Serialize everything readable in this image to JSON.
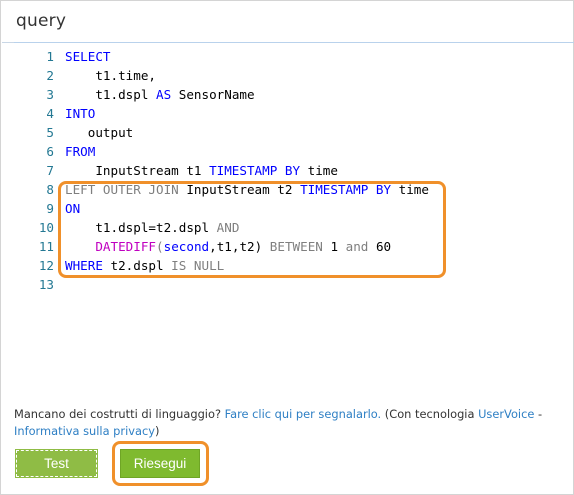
{
  "panel": {
    "title": "query"
  },
  "editor": {
    "lines": [
      {
        "n": "1",
        "tokens": [
          {
            "t": "SELECT",
            "c": "kw"
          }
        ]
      },
      {
        "n": "2",
        "tokens": [
          {
            "t": "    t1.time,",
            "c": "txt"
          }
        ]
      },
      {
        "n": "3",
        "tokens": [
          {
            "t": "    t1.dspl ",
            "c": "txt"
          },
          {
            "t": "AS",
            "c": "kw"
          },
          {
            "t": " SensorName",
            "c": "txt"
          }
        ]
      },
      {
        "n": "4",
        "tokens": [
          {
            "t": "INTO",
            "c": "kw"
          }
        ]
      },
      {
        "n": "5",
        "tokens": [
          {
            "t": "   output",
            "c": "txt"
          }
        ]
      },
      {
        "n": "6",
        "tokens": [
          {
            "t": "FROM",
            "c": "kw"
          }
        ]
      },
      {
        "n": "7",
        "tokens": [
          {
            "t": "    InputStream t1 ",
            "c": "txt"
          },
          {
            "t": "TIMESTAMP BY",
            "c": "kw"
          },
          {
            "t": " time",
            "c": "txt"
          }
        ]
      },
      {
        "n": "8",
        "tokens": [
          {
            "t": "LEFT OUTER JOIN",
            "c": "kw-gray"
          },
          {
            "t": " InputStream t2 ",
            "c": "txt"
          },
          {
            "t": "TIMESTAMP BY",
            "c": "kw"
          },
          {
            "t": " time",
            "c": "txt"
          }
        ]
      },
      {
        "n": "9",
        "tokens": [
          {
            "t": "ON",
            "c": "kw"
          }
        ]
      },
      {
        "n": "10",
        "tokens": [
          {
            "t": "    t1.dspl=t2.dspl ",
            "c": "txt"
          },
          {
            "t": "AND",
            "c": "kw-gray"
          }
        ]
      },
      {
        "n": "11",
        "tokens": [
          {
            "t": "    ",
            "c": "txt"
          },
          {
            "t": "DATEDIFF",
            "c": "fn"
          },
          {
            "t": "(",
            "c": "kw-gray"
          },
          {
            "t": "second",
            "c": "kw"
          },
          {
            "t": ",t1,t2) ",
            "c": "txt"
          },
          {
            "t": "BETWEEN",
            "c": "kw-gray"
          },
          {
            "t": " 1 ",
            "c": "txt"
          },
          {
            "t": "and",
            "c": "kw-gray"
          },
          {
            "t": " 60",
            "c": "txt"
          }
        ]
      },
      {
        "n": "12",
        "tokens": [
          {
            "t": "WHERE",
            "c": "kw"
          },
          {
            "t": " t2.dspl ",
            "c": "txt"
          },
          {
            "t": "IS NULL",
            "c": "kw-gray"
          }
        ]
      },
      {
        "n": "13",
        "tokens": []
      }
    ]
  },
  "footer": {
    "prefix": "Mancano dei costrutti di linguaggio? ",
    "report_link": "Fare clic qui per segnalarlo.",
    "middle": " (Con tecnologia ",
    "uservoice_link": "UserVoice",
    "dash": " - ",
    "privacy_link": "Informativa sulla privacy",
    "suffix": ")"
  },
  "buttons": {
    "test": "Test",
    "run": "Riesegui"
  },
  "colors": {
    "keyword": "#0000ff",
    "highlight": "#f0902a",
    "button_green": "#7fba2f",
    "link": "#2e7fc4"
  }
}
